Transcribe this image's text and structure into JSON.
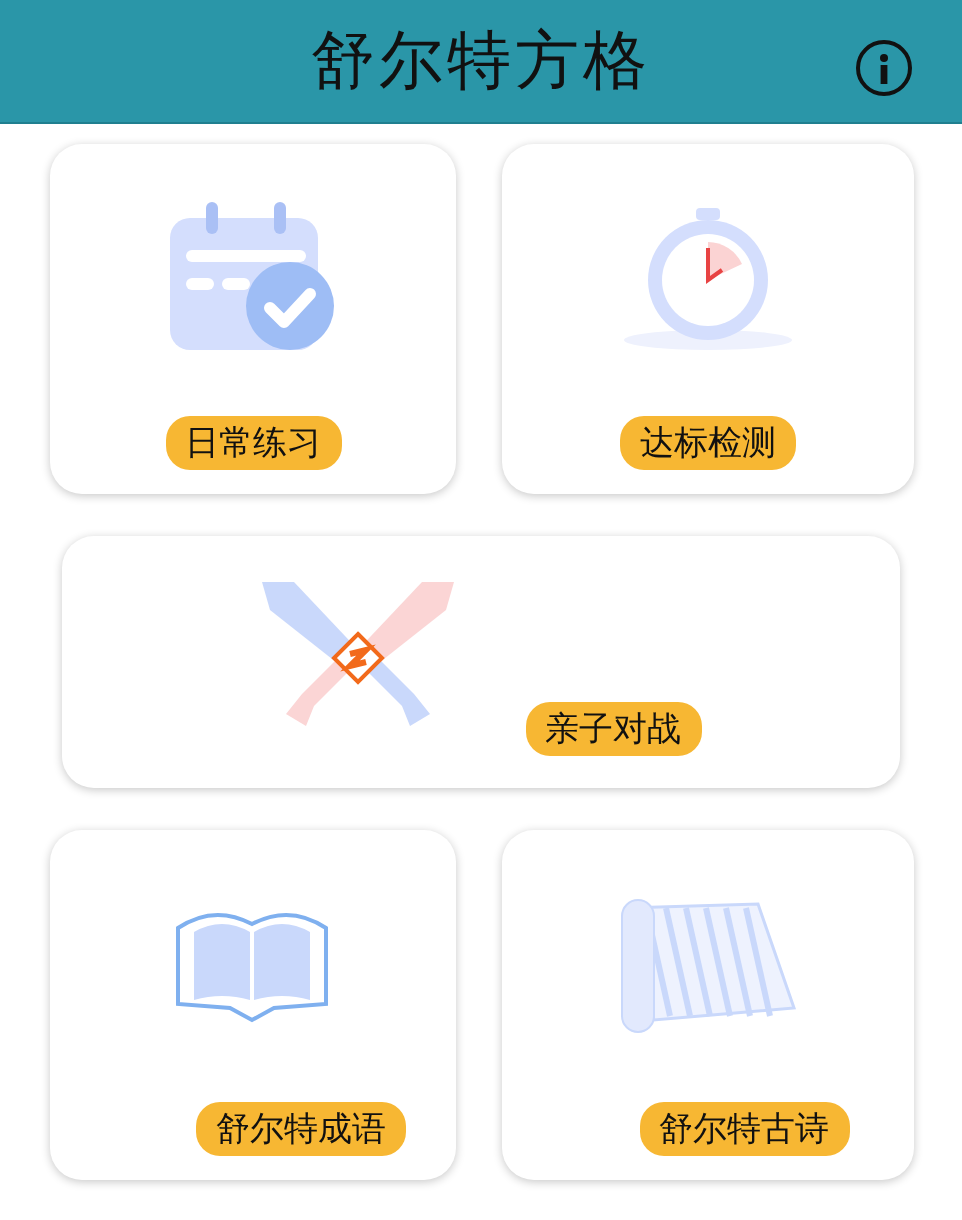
{
  "header": {
    "title": "舒尔特方格"
  },
  "cards": [
    {
      "kind": "calendar",
      "label": "日常练习"
    },
    {
      "kind": "stopwatch",
      "label": "达标检测"
    },
    {
      "kind": "swords",
      "label": "亲子对战"
    },
    {
      "kind": "book",
      "label": "舒尔特成语"
    },
    {
      "kind": "scroll",
      "label": "舒尔特古诗"
    }
  ]
}
